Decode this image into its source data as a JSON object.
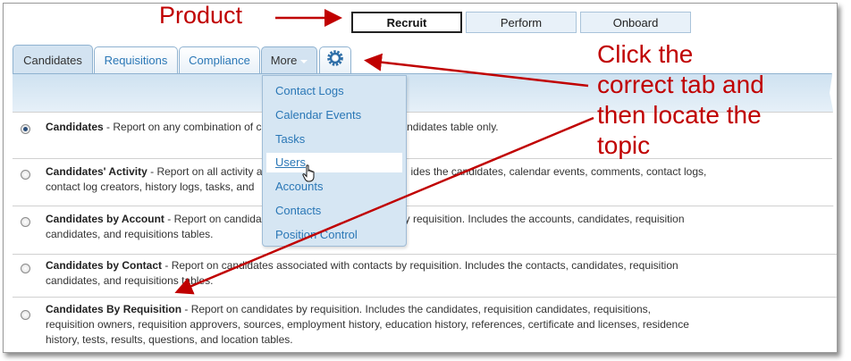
{
  "annotations": {
    "product_label": "Product",
    "tab_instruction_lines": [
      "Click the",
      "correct tab and",
      "then locate the",
      "topic"
    ]
  },
  "product_buttons": [
    {
      "label": "Recruit",
      "active": true
    },
    {
      "label": "Perform",
      "active": false
    },
    {
      "label": "Onboard",
      "active": false
    }
  ],
  "tabs": [
    {
      "label": "Candidates",
      "active": true
    },
    {
      "label": "Requisitions",
      "active": false
    },
    {
      "label": "Compliance",
      "active": false
    },
    {
      "label": "More",
      "active": false
    }
  ],
  "gear_icon": "gear-icon",
  "more_menu": {
    "items": [
      "Contact Logs",
      "Calendar Events",
      "Tasks",
      "Users",
      "Accounts",
      "Contacts",
      "Position Control"
    ],
    "hovered": "Users"
  },
  "reports": [
    {
      "title": "Candidates",
      "desc": " - Report on any combination of c",
      "desc_tail": "candidates table only.",
      "selected": true
    },
    {
      "title": "Candidates' Activity",
      "desc": " - Report on all activity as",
      "desc_tail": "ides the candidates, calendar events, comments, contact logs,",
      "line2": "contact log creators, history logs, tasks, and",
      "selected": false
    },
    {
      "title": "Candidates by Account",
      "desc": " - Report on candida",
      "desc_tail": "y requisition. Includes the accounts, candidates, requisition",
      "line2": "candidates, and requisitions tables.",
      "selected": false
    },
    {
      "title": "Candidates by Contact",
      "desc": " - Report on candidates associated with contacts by requisition. Includes the contacts, candidates, requisition",
      "line2": "candidates, and requisitions tables.",
      "selected": false
    },
    {
      "title": "Candidates By Requisition",
      "desc": " - Report on candidates by requisition. Includes the candidates, requisition candidates, requisitions,",
      "line2": "requisition owners, requisition approvers, sources, employment history, education history, references, certificate and licenses, residence",
      "line3": "history, tests, results, questions, and location tables.",
      "selected": false
    }
  ],
  "colors": {
    "annotation": "#c00000",
    "link": "#2a77b6",
    "tab_active_bg": "#d3e3f1"
  }
}
